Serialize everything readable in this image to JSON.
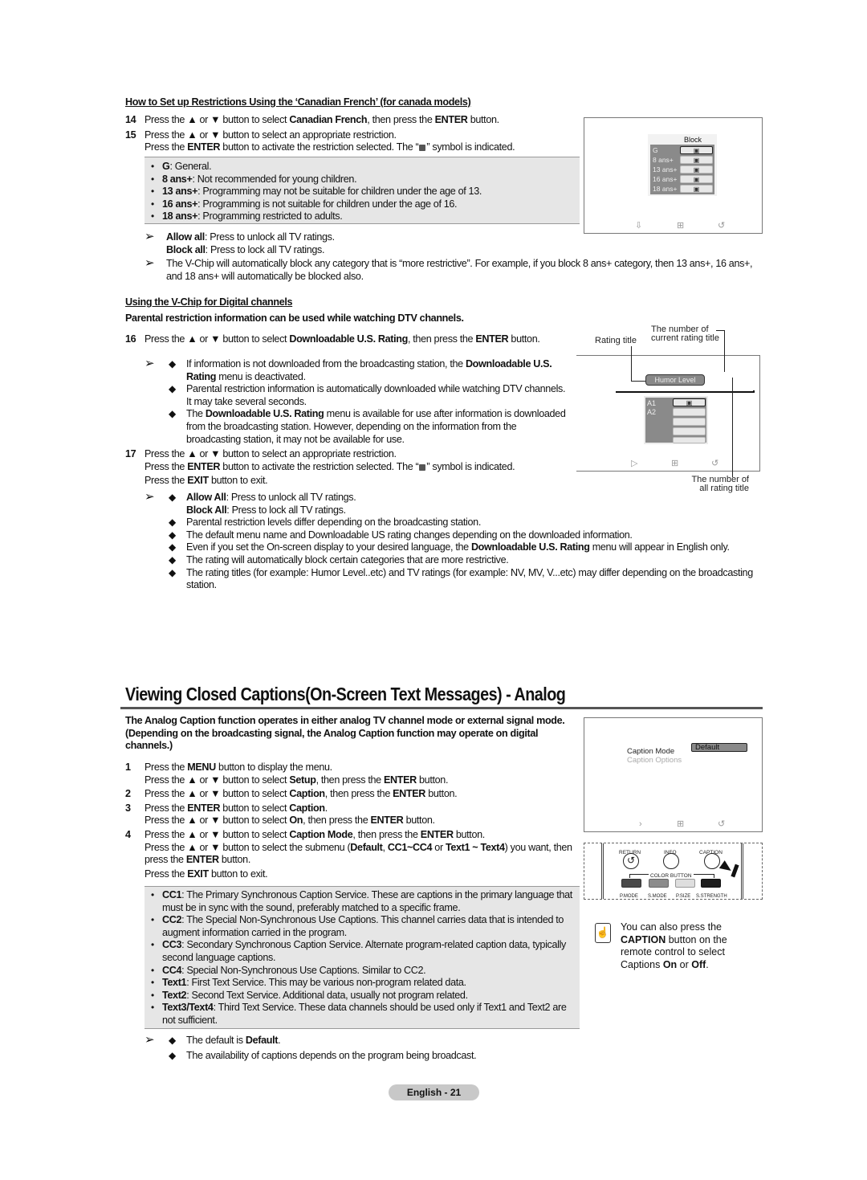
{
  "section1": {
    "heading": "How to Set up Restrictions Using the ‘Canadian French’ (for canada models)",
    "steps": [
      {
        "num": "14",
        "lines": [
          [
            "Press the ▲ or ▼ button to select ",
            "Canadian French",
            ", then press the ",
            "ENTER",
            " button."
          ]
        ]
      },
      {
        "num": "15",
        "lines": [
          [
            "Press the ▲ or ▼ button to select an appropriate restriction."
          ],
          [
            "Press the ",
            "ENTER",
            " button to activate the restriction selected. The “",
            "lock",
            "” symbol is indicated."
          ]
        ]
      }
    ],
    "ratings": [
      {
        "term": "G",
        "desc": ": General."
      },
      {
        "term": "8 ans+",
        "desc": ": Not recommended for young children."
      },
      {
        "term": "13 ans+",
        "desc": ": Programming may not be suitable for children under the age of 13."
      },
      {
        "term": "16 ans+",
        "desc": ": Programming is not suitable for children under the age of 16."
      },
      {
        "term": "18 ans+",
        "desc": ": Programming restricted to adults."
      }
    ],
    "notes": {
      "allow_term": "Allow all",
      "allow_desc": ": Press to unlock all TV ratings.",
      "block_term": "Block all",
      "block_desc": ": Press to lock all TV ratings.",
      "vchip_note": "The V-Chip will automatically block any category that is “more restrictive”. For example, if you block 8 ans+ category, then 13 ans+, 16 ans+, and 18 ans+ will automatically be blocked also."
    },
    "screen": {
      "column_header": "Block",
      "rows": [
        "G",
        "8  ans+",
        "13 ans+",
        "16 ans+",
        "18 ans+"
      ]
    }
  },
  "section2": {
    "heading": "Using the V-Chip for Digital channels",
    "subheading": "Parental restriction information can be used while watching DTV channels.",
    "step16": {
      "num": "16",
      "pre": "Press the ▲ or ▼ button to select ",
      "b1": "Downloadable U.S. Rating",
      "mid": ", then press the ",
      "b2": "ENTER",
      "post": " button."
    },
    "step16_notes": {
      "n1_pre": "If information is not downloaded from the broadcasting station, the ",
      "n1_b": "Downloadable U.S. Rating",
      "n1_post": " menu is deactivated.",
      "n2": "Parental restriction information is automatically downloaded while watching DTV channels. It may take several seconds.",
      "n3_pre": "The ",
      "n3_b": "Downloadable U.S. Rating",
      "n3_post": " menu is available for use after information is downloaded from the broadcasting station. However, depending on the information from the broadcasting station, it may not be available for use."
    },
    "step17": {
      "num": "17",
      "l1": "Press the ▲ or ▼ button to select an appropriate restriction.",
      "l2_pre": "Press the ",
      "l2_b": "ENTER",
      "l2_mid": " button to activate the restriction selected. The “",
      "l2_post": "” symbol is indicated.",
      "l3_pre": "Press the ",
      "l3_b": "EXIT",
      "l3_post": " button to exit."
    },
    "step17_notes": {
      "allow_term": "Allow All",
      "allow_desc": ": Press to unlock all TV ratings.",
      "block_term": "Block All",
      "block_desc": ": Press to lock all TV ratings.",
      "n2": "Parental restriction levels differ depending on the broadcasting station.",
      "n3": "The default menu name and Downloadable US rating changes depending on the downloaded information.",
      "n4_pre": "Even if you set the On-screen display to your desired language, the ",
      "n4_b": "Downloadable U.S. Rating",
      "n4_post": " menu will appear in English only.",
      "n5": "The rating will automatically block certain categories that are more restrictive.",
      "n6": "The rating titles (for example: Humor Level..etc) and TV ratings (for example: NV, MV, V...etc) may differ depending on the broadcasting station."
    },
    "diagram": {
      "callout_rating_title": "Rating title",
      "callout_current": "The number of current rating title",
      "callout_all": "The number of all rating title",
      "rating_title": "Humor Level",
      "rows": [
        "A1",
        "A2"
      ]
    }
  },
  "section3": {
    "title": "Viewing Closed Captions(On-Screen Text Messages) - Analog",
    "intro": "The Analog Caption function operates in either analog TV channel mode or external signal mode. (Depending on the broadcasting signal, the Analog Caption function may operate on digital channels.)",
    "steps": {
      "s1_num": "1",
      "s1_l1_pre": "Press the ",
      "s1_l1_b": "MENU",
      "s1_l1_post": " button to display the menu.",
      "s1_l2_pre": "Press the ▲ or ▼ button to select ",
      "s1_l2_b": "Setup",
      "s1_l2_mid": ", then press the ",
      "s1_l2_b2": "ENTER",
      "s1_l2_post": " button.",
      "s2_num": "2",
      "s2_pre": "Press the ▲ or ▼ button to select ",
      "s2_b": "Caption",
      "s2_mid": ", then press the ",
      "s2_b2": "ENTER",
      "s2_post": " button.",
      "s3_num": "3",
      "s3_l1_pre": "Press the ",
      "s3_l1_b": "ENTER",
      "s3_l1_mid": " button to select ",
      "s3_l1_b2": "Caption",
      "s3_l1_post": ".",
      "s3_l2_pre": "Press the ▲ or ▼ button to select ",
      "s3_l2_b": "On",
      "s3_l2_mid": ", then press the ",
      "s3_l2_b2": "ENTER",
      "s3_l2_post": " button.",
      "s4_num": "4",
      "s4_l1_pre": "Press the ▲ or ▼ button to select ",
      "s4_l1_b": "Caption Mode",
      "s4_l1_mid": ", then press the ",
      "s4_l1_b2": "ENTER",
      "s4_l1_post": " button.",
      "s4_l2_pre": "Press the ▲ or ▼ button to select the submenu (",
      "s4_l2_b1": "Default",
      "s4_l2_c1": ", ",
      "s4_l2_b2": "CC1~CC4",
      "s4_l2_c2": " or ",
      "s4_l2_b3": "Text1 ~ Text4",
      "s4_l2_post": ") you want, then press the ",
      "s4_l2_b4": "ENTER",
      "s4_l2_end": " button.",
      "s4_l3_pre": "Press the ",
      "s4_l3_b": "EXIT",
      "s4_l3_post": " button to exit."
    },
    "services": [
      {
        "term": "CC1",
        "desc": ": The Primary Synchronous Caption Service. These are captions in the primary language that must be in sync with the sound, preferably matched to a specific frame."
      },
      {
        "term": "CC2",
        "desc": ": The Special Non-Synchronous Use Captions. This channel carries data that is intended to augment information carried in the program."
      },
      {
        "term": "CC3",
        "desc": ": Secondary Synchronous Caption Service. Alternate program-related caption data, typically second language captions."
      },
      {
        "term": "CC4",
        "desc": ": Special Non-Synchronous Use Captions. Similar to CC2."
      },
      {
        "term": "Text1",
        "desc": ": First Text Service. This may be various non-program related data."
      },
      {
        "term": "Text2",
        "desc": ": Second Text Service. Additional data, usually not program related."
      },
      {
        "term": "Text3/Text4",
        "desc": ": Third Text Service. These data channels should be used only if Text1 and Text2 are not sufficient."
      }
    ],
    "notes": {
      "n1_pre": "The default is ",
      "n1_b": "Default",
      "n1_post": ".",
      "n2": "The availability of captions depends on the program being broadcast."
    },
    "screen": {
      "item1": "Caption Mode",
      "item1_value": "Default",
      "item2": "Caption Options"
    },
    "remote": {
      "return_label": "RETURN",
      "info_label": "INFO",
      "caption_label": "CAPTION",
      "color_button_label": "COLOR BUTTON",
      "buttons": [
        {
          "label": "P.MODE",
          "color": "#4a4a4a"
        },
        {
          "label": "S.MODE",
          "color": "#8c8c8c"
        },
        {
          "label": "P.SIZE",
          "color": "#dedede"
        },
        {
          "label": "S.STRENGTH",
          "color": "#1e1e1e"
        }
      ]
    },
    "tip": {
      "pre": "You can also press the ",
      "b1": "CAPTION",
      "mid": " button on the remote control to select Captions ",
      "b2": "On",
      "or": " or ",
      "b3": "Off",
      "post": "."
    }
  },
  "footer": {
    "page_label": "English - 21"
  }
}
